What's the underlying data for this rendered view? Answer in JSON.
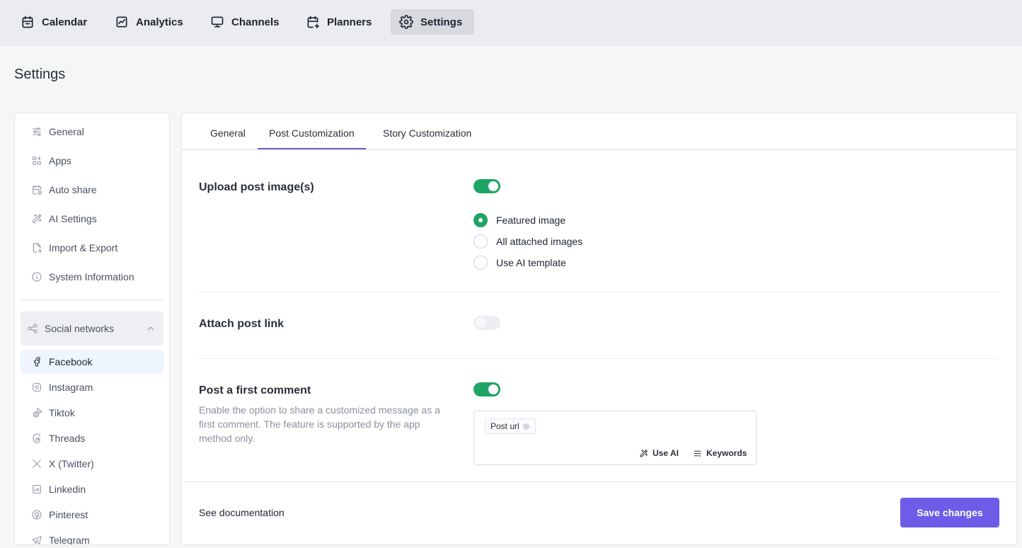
{
  "topnav": {
    "items": [
      {
        "label": "Calendar",
        "icon": "calendar-icon"
      },
      {
        "label": "Analytics",
        "icon": "analytics-icon"
      },
      {
        "label": "Channels",
        "icon": "monitor-icon"
      },
      {
        "label": "Planners",
        "icon": "calendar-plus-icon"
      },
      {
        "label": "Settings",
        "icon": "gear-icon",
        "active": true
      }
    ]
  },
  "page": {
    "title": "Settings"
  },
  "sidebar": {
    "items": [
      {
        "label": "General",
        "icon": "sliders-icon"
      },
      {
        "label": "Apps",
        "icon": "apps-icon"
      },
      {
        "label": "Auto share",
        "icon": "calendar-clock-icon"
      },
      {
        "label": "AI Settings",
        "icon": "magic-wand-icon"
      },
      {
        "label": "Import & Export",
        "icon": "file-export-icon"
      },
      {
        "label": "System Information",
        "icon": "info-icon"
      }
    ],
    "group": {
      "label": "Social networks",
      "icon": "share-icon",
      "expanded": true
    },
    "networks": [
      {
        "label": "Facebook",
        "icon": "facebook-icon",
        "selected": true
      },
      {
        "label": "Instagram",
        "icon": "instagram-icon"
      },
      {
        "label": "Tiktok",
        "icon": "tiktok-icon"
      },
      {
        "label": "Threads",
        "icon": "threads-icon"
      },
      {
        "label": "X (Twitter)",
        "icon": "x-icon"
      },
      {
        "label": "Linkedin",
        "icon": "linkedin-icon"
      },
      {
        "label": "Pinterest",
        "icon": "pinterest-icon"
      },
      {
        "label": "Telegram",
        "icon": "telegram-icon"
      }
    ]
  },
  "tabs": [
    {
      "label": "General"
    },
    {
      "label": "Post Customization",
      "active": true
    },
    {
      "label": "Story Customization"
    }
  ],
  "settings": {
    "upload": {
      "label": "Upload post image(s)",
      "enabled": true,
      "options": [
        {
          "label": "Featured image",
          "checked": true
        },
        {
          "label": "All attached images",
          "checked": false
        },
        {
          "label": "Use AI template",
          "checked": false
        }
      ]
    },
    "attach_link": {
      "label": "Attach post link",
      "enabled": false
    },
    "first_comment": {
      "label": "Post a first comment",
      "description": "Enable the option to share a customized message as a first comment. The feature is supported by the app method only.",
      "enabled": true,
      "chip": "Post url",
      "use_ai_label": "Use AI",
      "keywords_label": "Keywords"
    }
  },
  "footer": {
    "doc_link": "See documentation",
    "save_label": "Save changes"
  },
  "colors": {
    "accent": "#6d5ce8",
    "toggle_on": "#1fa463",
    "tab_underline": "#6b5bd2"
  }
}
